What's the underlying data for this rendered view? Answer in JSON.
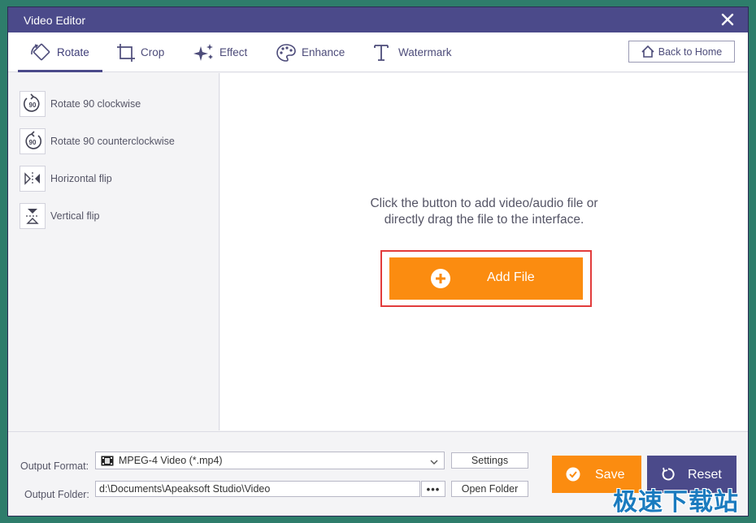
{
  "window": {
    "title": "Video Editor"
  },
  "tabs": [
    {
      "label": "Rotate",
      "icon": "rotate-icon",
      "active": true
    },
    {
      "label": "Crop",
      "icon": "crop-icon",
      "active": false
    },
    {
      "label": "Effect",
      "icon": "effect-sparkle-icon",
      "active": false
    },
    {
      "label": "Enhance",
      "icon": "enhance-palette-icon",
      "active": false
    },
    {
      "label": "Watermark",
      "icon": "watermark-text-icon",
      "active": false
    }
  ],
  "back_home": {
    "label": "Back to Home",
    "icon": "home-icon"
  },
  "rotate_options": [
    {
      "label": "Rotate 90 clockwise",
      "icon": "rotate-clockwise-icon"
    },
    {
      "label": "Rotate 90 counterclockwise",
      "icon": "rotate-counterclockwise-icon"
    },
    {
      "label": "Horizontal flip",
      "icon": "horizontal-flip-icon"
    },
    {
      "label": "Vertical flip",
      "icon": "vertical-flip-icon"
    }
  ],
  "main": {
    "hint_line1": "Click the button to add video/audio file or",
    "hint_line2": "directly drag the file to the interface.",
    "add_file_label": "Add File"
  },
  "output": {
    "format_label": "Output Format:",
    "format_value": "MPEG-4 Video (*.mp4)",
    "settings_label": "Settings",
    "folder_label": "Output Folder:",
    "folder_value": "d:\\Documents\\Apeaksoft Studio\\Video",
    "browse_label": "•••",
    "open_folder_label": "Open Folder"
  },
  "actions": {
    "save_label": "Save",
    "reset_label": "Reset"
  },
  "site_watermark": "极速下载站",
  "colors": {
    "accent_purple": "#4b4a8a",
    "accent_orange": "#fb8c10",
    "highlight_red": "#e23c3c"
  }
}
